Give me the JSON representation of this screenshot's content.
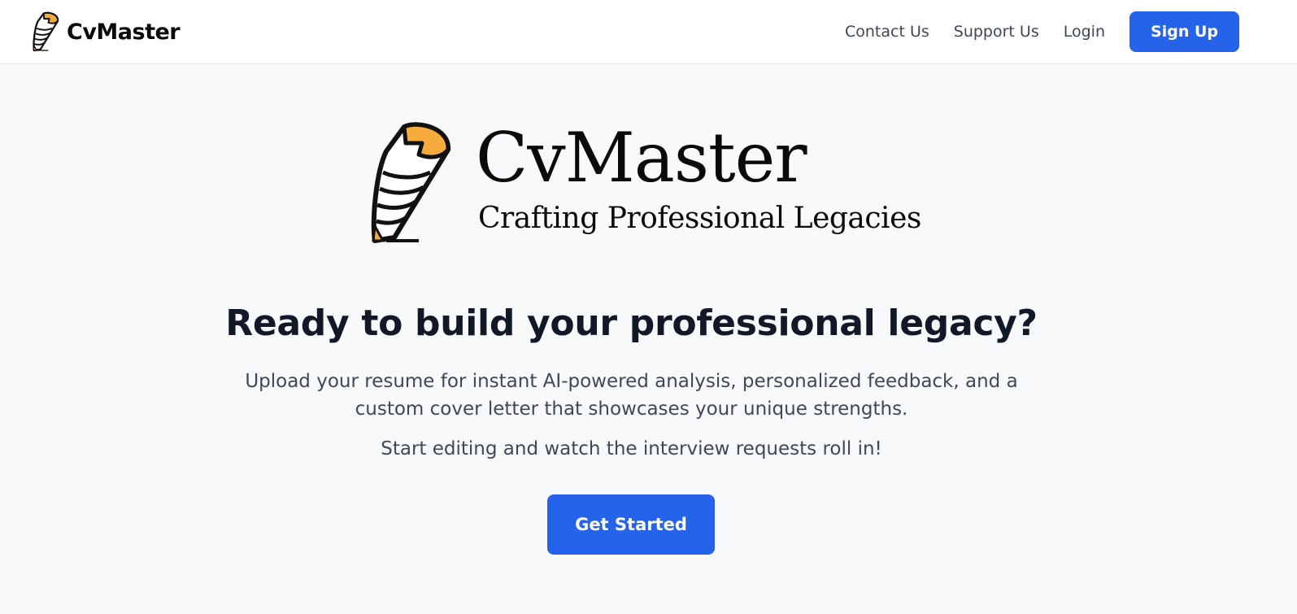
{
  "navbar": {
    "brand_name": "CvMaster",
    "brand_icon": "pencil-logo-icon",
    "links": [
      {
        "label": "Contact Us"
      },
      {
        "label": "Support Us"
      },
      {
        "label": "Login"
      }
    ],
    "signup_label": "Sign Up"
  },
  "hero": {
    "logo_icon": "pencil-logo-icon",
    "logo_name": "CvMaster",
    "logo_tagline": "Crafting Professional Legacies",
    "headline": "Ready to build your professional legacy?",
    "description": "Upload your resume for instant AI-powered analysis, personalized feedback, and a custom cover letter that showcases your unique strengths.",
    "subtext": "Start editing and watch the interview requests roll in!",
    "cta_label": "Get Started"
  },
  "colors": {
    "accent": "#2563eb",
    "background": "#f8f9fb",
    "pencil_tip": "#f5ac3c"
  }
}
